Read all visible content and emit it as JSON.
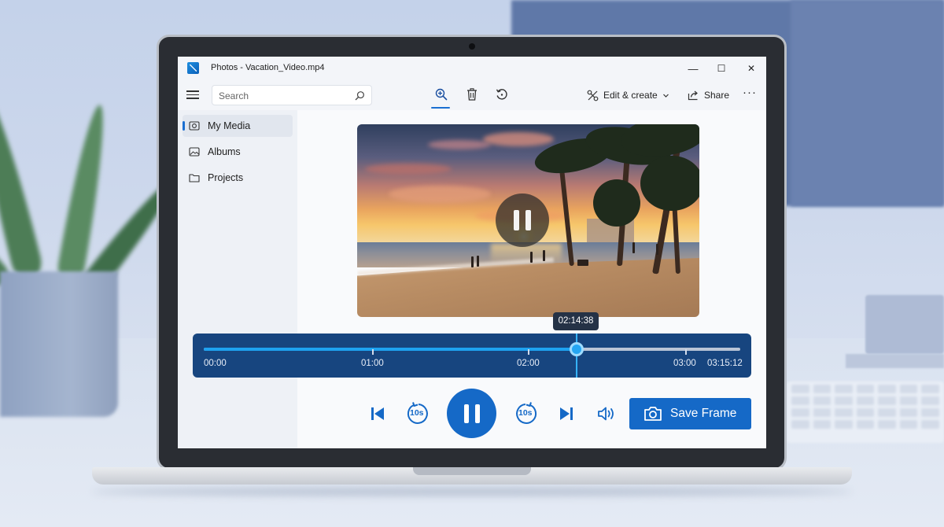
{
  "window": {
    "title": "Photos - Vacation_Video.mp4",
    "minimize": "—",
    "maximize": "☐",
    "close": "✕"
  },
  "toolbar": {
    "search_placeholder": "Search",
    "edit_create_label": "Edit & create",
    "share_label": "Share",
    "more_label": "···",
    "icons": [
      "zoom-in-icon",
      "trash-icon",
      "rotate-icon"
    ]
  },
  "sidebar": {
    "items": [
      {
        "label": "My Media",
        "icon": "photo-icon",
        "active": true
      },
      {
        "label": "Albums",
        "icon": "album-icon",
        "active": false
      },
      {
        "label": "Projects",
        "icon": "folder-icon",
        "active": false
      }
    ]
  },
  "player": {
    "state": "playing",
    "current_time": "02:14:38",
    "duration": "03:15:12",
    "progress_fraction": 0.69,
    "timeline_labels": [
      "00:00",
      "01:00",
      "02:00",
      "03:00",
      "03:15:12"
    ]
  },
  "controls": {
    "skip_back_label": "10s",
    "skip_forward_label": "10s",
    "save_frame_label": "Save Frame"
  },
  "colors": {
    "accent": "#1569c7",
    "timeline_bg": "#17457f",
    "progress": "#1ea2f0"
  }
}
